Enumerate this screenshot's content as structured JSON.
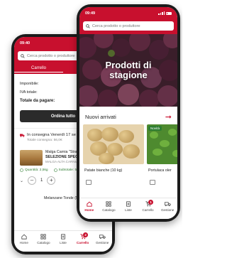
{
  "brand_color": "#c8102e",
  "back_screen": {
    "status_time": "09:40",
    "search_placeholder": "Cerca prodotto o produttore",
    "tabs": [
      "Carrello",
      "Acquis"
    ],
    "summary": {
      "imponibile_label": "Imponibile:",
      "iva_label": "IVA totale:",
      "totale_label": "Totale da pagare:"
    },
    "order_button": "Ordina tutto",
    "delivery": {
      "title": "In consegna Venerdì 17 se",
      "subtitle": "Totale consegna: 56,0€"
    },
    "item": {
      "name": "Malga Carnia \"Stra",
      "selection": "SELEZIONE SPECIA",
      "producer": "MALGA ALTA CARNIA",
      "quantity": "Quantità: 2,5kg",
      "subtotal": "Subtotale: 5"
    },
    "qty_value": "1",
    "next_item": "Melanzane Tonde (5kg)",
    "nav": [
      "Home",
      "Catalogo",
      "Liste",
      "Carrello",
      "Gestione"
    ],
    "cart_badge": "2"
  },
  "front_screen": {
    "status_time": "09:49",
    "search_placeholder": "Cerca prodotto o produttore",
    "hero_title_line1": "Prodotti di",
    "hero_title_line2": "stagione",
    "new_arrivals_label": "Nuovi arrivati",
    "products": [
      {
        "name": "Patate bianche (10 kg)",
        "badge": ""
      },
      {
        "name": "Portulaca oler",
        "badge": "Novità"
      }
    ],
    "nav": [
      "Home",
      "Catalogo",
      "Liste",
      "Carrello",
      "Gestione"
    ],
    "cart_badge": "1"
  }
}
